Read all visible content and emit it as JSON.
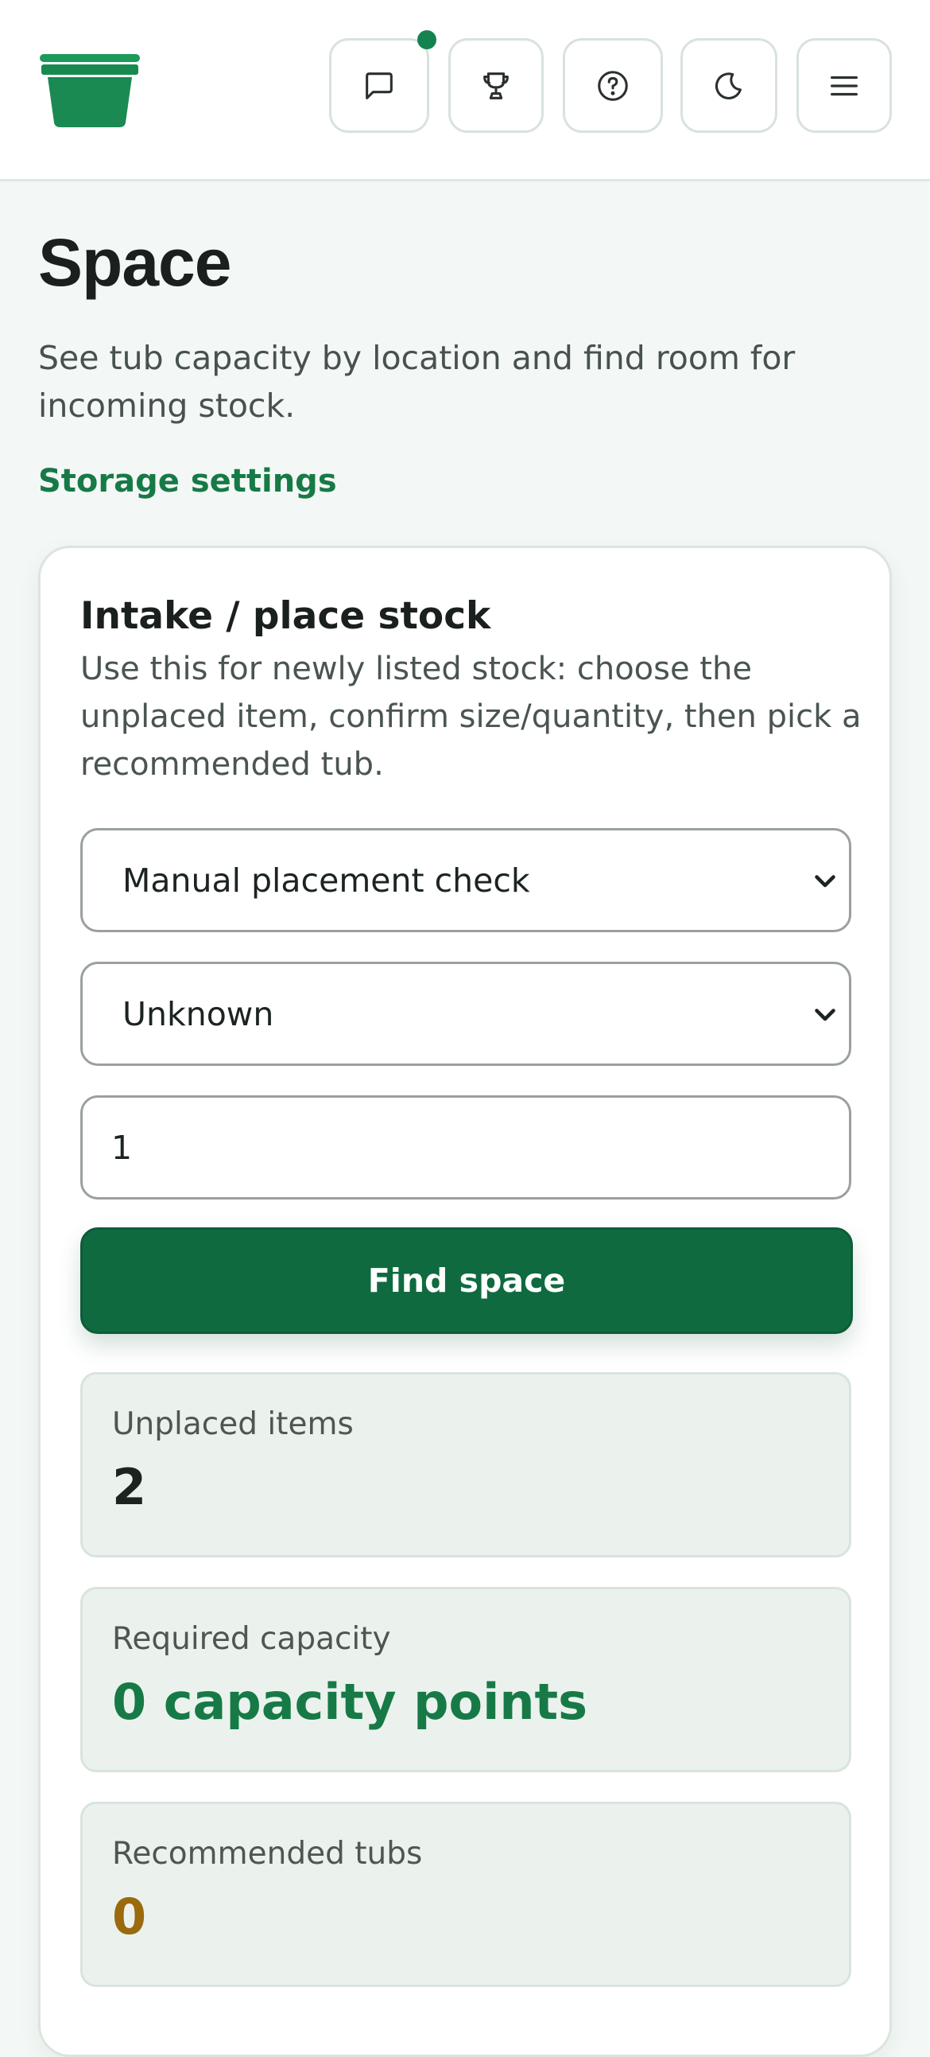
{
  "header": {
    "notification_dot": true
  },
  "page": {
    "title": "Space",
    "subtitle": "See tub capacity by location and find room for incoming stock.",
    "settings_link": "Storage settings"
  },
  "intake": {
    "title": "Intake / place stock",
    "description": "Use this for newly listed stock: choose the unplaced item, confirm size/quantity, then pick a recommended tub.",
    "item_select": {
      "value": "Manual placement check"
    },
    "size_select": {
      "value": "Unknown"
    },
    "quantity": {
      "value": "1"
    },
    "find_button": "Find space",
    "stats": [
      {
        "label": "Unplaced items",
        "value": "2",
        "color": "#1c2420"
      },
      {
        "label": "Required capacity",
        "value": "0 capacity points",
        "color": "#177a46"
      },
      {
        "label": "Recommended tubs",
        "value": "0",
        "color": "#9a6a0d"
      }
    ]
  },
  "colors": {
    "brand": "#177a46",
    "primary_button": "#0f6a40",
    "warning": "#9a6a0d"
  }
}
